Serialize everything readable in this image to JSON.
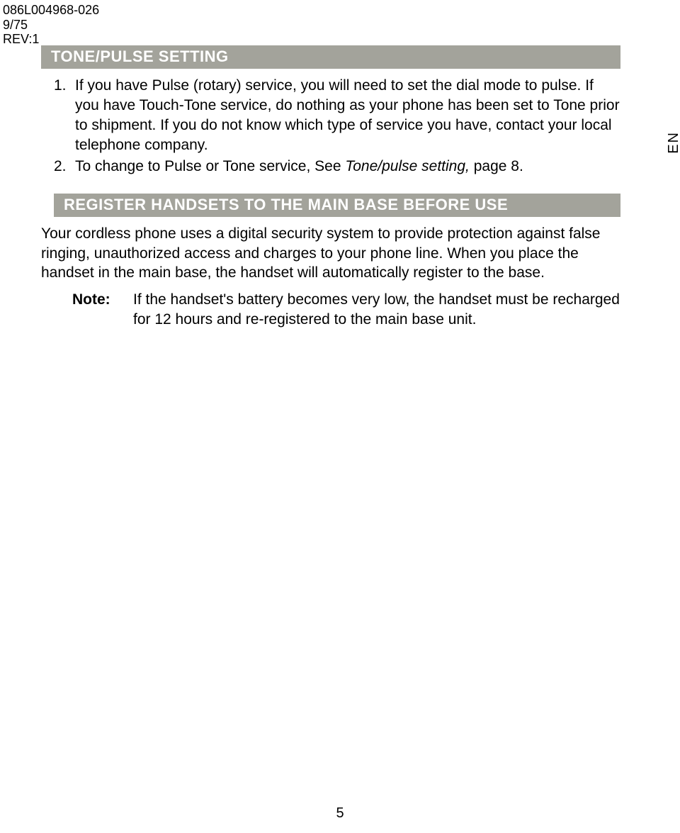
{
  "meta": {
    "doc_id": "086L004968-026",
    "page_of": "9/75",
    "rev": "REV:1"
  },
  "side_tab": "EN",
  "page_number": "5",
  "section1": {
    "heading": "TONE/PULSE SETTING",
    "items": [
      {
        "num": "1.",
        "text": "If you have Pulse (rotary) service, you will need to set the dial mode to pulse. If you have Touch-Tone service, do nothing as your phone has been set to Tone prior to shipment. If you do not know which type of service you have, contact your local telephone company."
      },
      {
        "num": "2.",
        "text_pre": "To change to Pulse or Tone service, See ",
        "text_italic": "Tone/pulse setting,",
        "text_post": " page 8."
      }
    ]
  },
  "section2": {
    "heading": "REGISTER HANDSETS TO THE MAIN BASE BEFORE USE",
    "para": "Your cordless phone uses a digital security system to provide protection against false ringing, unauthorized access and charges to your phone line. When you place the handset in the main base, the handset will automatically register to the base.",
    "note_label": "Note:",
    "note_text": "If the handset's battery becomes very low, the handset must be recharged for 12 hours and re-registered to the main base unit."
  }
}
